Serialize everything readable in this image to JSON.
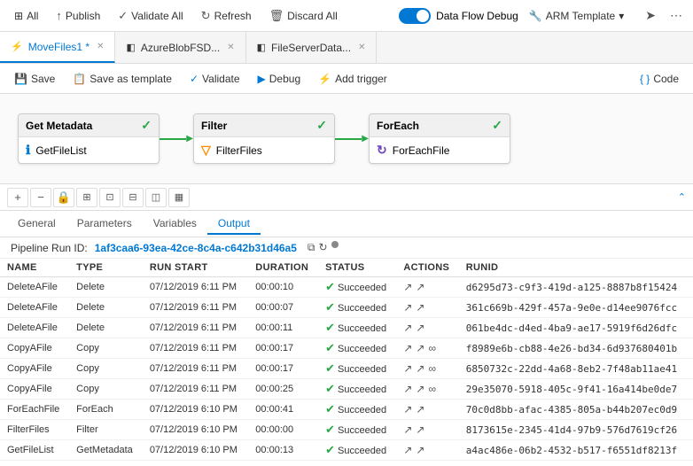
{
  "topbar": {
    "publish_label": "Publish",
    "validate_all_label": "Validate All",
    "refresh_label": "Refresh",
    "discard_all_label": "Discard All",
    "data_flow_debug_label": "Data Flow Debug",
    "arm_template_label": "ARM Template"
  },
  "tabs": [
    {
      "id": "movefile",
      "label": "MoveFiles1",
      "icon": "⚡",
      "active": true,
      "modified": true
    },
    {
      "id": "azureblob",
      "label": "AzureBlobFSD...",
      "icon": "◧",
      "active": false,
      "modified": false
    },
    {
      "id": "fileserver",
      "label": "FileServerData...",
      "icon": "◧",
      "active": false,
      "modified": false
    }
  ],
  "secbar": {
    "save_label": "Save",
    "save_template_label": "Save as template",
    "validate_label": "Validate",
    "debug_label": "Debug",
    "add_trigger_label": "Add trigger",
    "code_label": "Code"
  },
  "canvas": {
    "nodes": [
      {
        "id": "get-metadata",
        "title": "Get Metadata",
        "body_icon": "ℹ",
        "body_label": "GetFileList",
        "type": "info"
      },
      {
        "id": "filter",
        "title": "Filter",
        "body_icon": "▽",
        "body_label": "FilterFiles",
        "type": "filter"
      },
      {
        "id": "foreach",
        "title": "ForEach",
        "body_icon": "↻",
        "body_label": "ForEachFile",
        "type": "foreach"
      }
    ]
  },
  "zoom_tools": [
    "+",
    "−",
    "🔒",
    "⊞",
    "⊡",
    "⊟",
    "⊠",
    "▦"
  ],
  "panel_tabs": [
    "General",
    "Parameters",
    "Variables",
    "Output"
  ],
  "active_panel_tab": "Output",
  "pipeline_run_id_label": "Pipeline Run ID:",
  "pipeline_run_id": "1af3caa6-93ea-42ce-8c4a-c642b31d46a5",
  "table": {
    "columns": [
      "NAME",
      "TYPE",
      "RUN START",
      "DURATION",
      "STATUS",
      "ACTIONS",
      "RUNID"
    ],
    "rows": [
      {
        "name": "DeleteAFile",
        "type": "Delete",
        "run_start": "07/12/2019 6:11 PM",
        "duration": "00:00:10",
        "status": "Succeeded",
        "runid": "d6295d73-c9f3-419d-a125-8887b8f15424"
      },
      {
        "name": "DeleteAFile",
        "type": "Delete",
        "run_start": "07/12/2019 6:11 PM",
        "duration": "00:00:07",
        "status": "Succeeded",
        "runid": "361c669b-429f-457a-9e0e-d14ee9076fcc"
      },
      {
        "name": "DeleteAFile",
        "type": "Delete",
        "run_start": "07/12/2019 6:11 PM",
        "duration": "00:00:11",
        "status": "Succeeded",
        "runid": "061be4dc-d4ed-4ba9-ae17-5919f6d26dfc"
      },
      {
        "name": "CopyAFile",
        "type": "Copy",
        "run_start": "07/12/2019 6:11 PM",
        "duration": "00:00:17",
        "status": "Succeeded",
        "runid": "f8989e6b-cb88-4e26-bd34-6d937680401b",
        "extra_actions": true
      },
      {
        "name": "CopyAFile",
        "type": "Copy",
        "run_start": "07/12/2019 6:11 PM",
        "duration": "00:00:17",
        "status": "Succeeded",
        "runid": "6850732c-22dd-4a68-8eb2-7f48ab11ae41",
        "extra_actions": true
      },
      {
        "name": "CopyAFile",
        "type": "Copy",
        "run_start": "07/12/2019 6:11 PM",
        "duration": "00:00:25",
        "status": "Succeeded",
        "runid": "29e35070-5918-405c-9f41-16a414be0de7",
        "extra_actions": true
      },
      {
        "name": "ForEachFile",
        "type": "ForEach",
        "run_start": "07/12/2019 6:10 PM",
        "duration": "00:00:41",
        "status": "Succeeded",
        "runid": "70c0d8bb-afac-4385-805a-b44b207ec0d9"
      },
      {
        "name": "FilterFiles",
        "type": "Filter",
        "run_start": "07/12/2019 6:10 PM",
        "duration": "00:00:00",
        "status": "Succeeded",
        "runid": "8173615e-2345-41d4-97b9-576d7619cf26"
      },
      {
        "name": "GetFileList",
        "type": "GetMetadata",
        "run_start": "07/12/2019 6:10 PM",
        "duration": "00:00:13",
        "status": "Succeeded",
        "runid": "a4ac486e-06b2-4532-b517-f6551df8213f"
      }
    ]
  }
}
